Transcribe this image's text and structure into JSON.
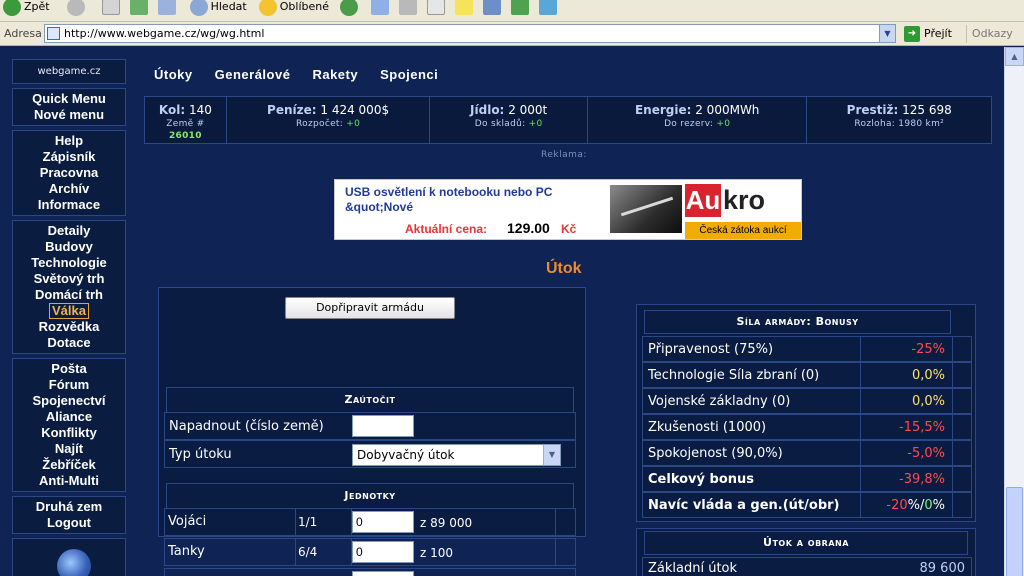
{
  "browser": {
    "toolbar": {
      "back_label": "Zpět",
      "search_label": "Hledat",
      "favorites_label": "Oblíbené"
    },
    "address_label": "Adresa",
    "url": "http://www.webgame.cz/wg/wg.html",
    "go_label": "Přejít",
    "links_label": "Odkazy"
  },
  "sidebar": {
    "brand": "webgame.cz",
    "group1": [
      "Quick Menu",
      "Nové menu"
    ],
    "group2": [
      "Help",
      "Zápisník",
      "Pracovna",
      "Archív",
      "Informace"
    ],
    "group3": [
      "Detaily",
      "Budovy",
      "Technologie",
      "Světový trh",
      "Domácí trh",
      "Válka",
      "Rozvědka",
      "Dotace"
    ],
    "group4": [
      "Pošta",
      "Fórum",
      "Spojenectví",
      "Aliance",
      "Konflikty",
      "Najít",
      "Žebříček",
      "Anti-Multi"
    ],
    "group5": [
      "Druhá zem",
      "Logout"
    ],
    "active_item": "Válka"
  },
  "topnav": [
    "Útoky",
    "Generálové",
    "Rakety",
    "Spojenci"
  ],
  "stats": {
    "kol_label": "Kol:",
    "kol_value": "140",
    "zeme_label": "Země #",
    "zeme_value": "26010",
    "penize_label": "Peníze:",
    "penize_value": "1 424 000$",
    "penize_sub_label": "Rozpočet:",
    "penize_sub_value": "+0",
    "jidlo_label": "Jídlo:",
    "jidlo_value": "2 000t",
    "jidlo_sub_label": "Do skladů:",
    "jidlo_sub_value": "+0",
    "energie_label": "Energie:",
    "energie_value": "2 000MWh",
    "energie_sub_label": "Do rezerv:",
    "energie_sub_value": "+0",
    "prestiz_label": "Prestiž:",
    "prestiz_value": "125 698",
    "rozloha_label": "Rozloha:",
    "rozloha_value": "1980 km²"
  },
  "reklama_label": "Reklama:",
  "ad": {
    "title": "USB osvětlení k notebooku nebo PC &quot;Nové",
    "price_label": "Aktuální cena:",
    "price": "129.00",
    "currency": "Kč",
    "logo_au": "Au",
    "logo_kro": "kro",
    "tagline": "Česká zátoka aukcí"
  },
  "page_title": "Útok",
  "attack_form": {
    "prepare_button": "Dopřipravit armádu",
    "attack_header": "Zaútočit",
    "target_label": "Napadnout (číslo země)",
    "target_value": "",
    "type_label": "Typ útoku",
    "type_selected": "Dobyvačný útok",
    "units_header": "Jednotky",
    "units": [
      {
        "name": "Vojáci",
        "ratio": "1/1",
        "value": "0",
        "max": "z 89 000"
      },
      {
        "name": "Tanky",
        "ratio": "6/4",
        "value": "0",
        "max": "z 100"
      }
    ]
  },
  "bonus_table": {
    "header": "Síla armády: Bonusy",
    "rows": [
      {
        "label": "Připravenost (75%)",
        "value": "-25%",
        "color": "red",
        "bold": false
      },
      {
        "label": "Technologie Síla zbraní (0)",
        "value": "0,0%",
        "color": "yellow",
        "bold": false
      },
      {
        "label": "Vojenské základny (0)",
        "value": "0,0%",
        "color": "yellow",
        "bold": false
      },
      {
        "label": "Zkušenosti (1000)",
        "value": "-15,5%",
        "color": "red",
        "bold": false
      },
      {
        "label": "Spokojenost (90,0%)",
        "value": "-5,0%",
        "color": "red",
        "bold": false
      },
      {
        "label": "Celkový bonus",
        "value": "-39,8%",
        "color": "red",
        "bold": true
      }
    ],
    "extra_label": "Navíc vláda a gen.(út/obr)",
    "extra_attack": "-20",
    "extra_sep": "%/",
    "extra_defense": "0",
    "extra_pct": "%"
  },
  "attack_defense": {
    "header": "Útok a obrana",
    "row_label": "Základní útok",
    "row_value": "89 600"
  },
  "colors": {
    "page_bg": "#0f2454",
    "accent_orange": "#f08a2c",
    "negative": "#ff4b4b",
    "neutral": "#ffe06b",
    "positive": "#66e066"
  }
}
